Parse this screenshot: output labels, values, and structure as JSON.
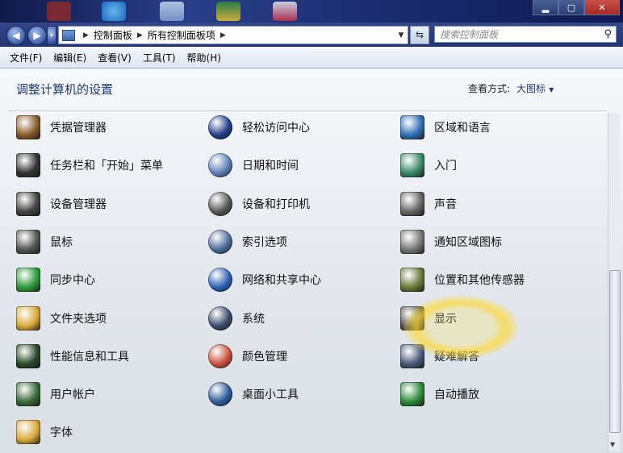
{
  "window": {
    "min_label": "▂",
    "max_label": "▢",
    "close_label": "✕"
  },
  "address": {
    "root": "控制面板",
    "current": "所有控制面板项"
  },
  "search": {
    "placeholder": "搜索控制面板"
  },
  "menu": [
    "文件(F)",
    "编辑(E)",
    "查看(V)",
    "工具(T)",
    "帮助(H)"
  ],
  "page": {
    "title": "调整计算机的设置",
    "view_label": "查看方式:",
    "view_value": "大图标"
  },
  "items": [
    {
      "label": "凭据管理器",
      "icon": "credential-manager-icon",
      "color": "#8a5a2a"
    },
    {
      "label": "轻松访问中心",
      "icon": "ease-of-access-icon",
      "color": "#1f3d8a"
    },
    {
      "label": "区域和语言",
      "icon": "region-globe-icon",
      "color": "#2e6fb5"
    },
    {
      "label": "任务栏和「开始」菜单",
      "icon": "taskbar-icon",
      "color": "#333333"
    },
    {
      "label": "日期和时间",
      "icon": "date-time-icon",
      "color": "#5a7fb8"
    },
    {
      "label": "入门",
      "icon": "getting-started-icon",
      "color": "#3a8a6a"
    },
    {
      "label": "设备管理器",
      "icon": "device-manager-icon",
      "color": "#444444"
    },
    {
      "label": "设备和打印机",
      "icon": "devices-printers-icon",
      "color": "#555555"
    },
    {
      "label": "声音",
      "icon": "speaker-icon",
      "color": "#666666"
    },
    {
      "label": "鼠标",
      "icon": "mouse-icon",
      "color": "#555555"
    },
    {
      "label": "索引选项",
      "icon": "indexing-icon",
      "color": "#4a6a9a"
    },
    {
      "label": "通知区域图标",
      "icon": "notification-area-icon",
      "color": "#777777"
    },
    {
      "label": "同步中心",
      "icon": "sync-center-icon",
      "color": "#2e9a3a"
    },
    {
      "label": "网络和共享中心",
      "icon": "network-sharing-icon",
      "color": "#2a5fb5"
    },
    {
      "label": "位置和其他传感器",
      "icon": "location-sensors-icon",
      "color": "#6a7a3a"
    },
    {
      "label": "文件夹选项",
      "icon": "folder-options-icon",
      "color": "#d9a93a"
    },
    {
      "label": "系统",
      "icon": "system-icon",
      "color": "#3a4a6a"
    },
    {
      "label": "显示",
      "icon": "display-icon",
      "color": "#555555"
    },
    {
      "label": "性能信息和工具",
      "icon": "performance-icon",
      "color": "#2a4a2a"
    },
    {
      "label": "颜色管理",
      "icon": "color-management-icon",
      "color": "#c8503a"
    },
    {
      "label": "疑难解答",
      "icon": "troubleshooting-icon",
      "color": "#4a5a7a"
    },
    {
      "label": "用户帐户",
      "icon": "user-accounts-icon",
      "color": "#3a6a3a"
    },
    {
      "label": "桌面小工具",
      "icon": "desktop-gadgets-icon",
      "color": "#2a5a9a"
    },
    {
      "label": "自动播放",
      "icon": "autoplay-icon",
      "color": "#2e8a3a"
    },
    {
      "label": "字体",
      "icon": "fonts-icon",
      "color": "#d9a93a"
    }
  ]
}
